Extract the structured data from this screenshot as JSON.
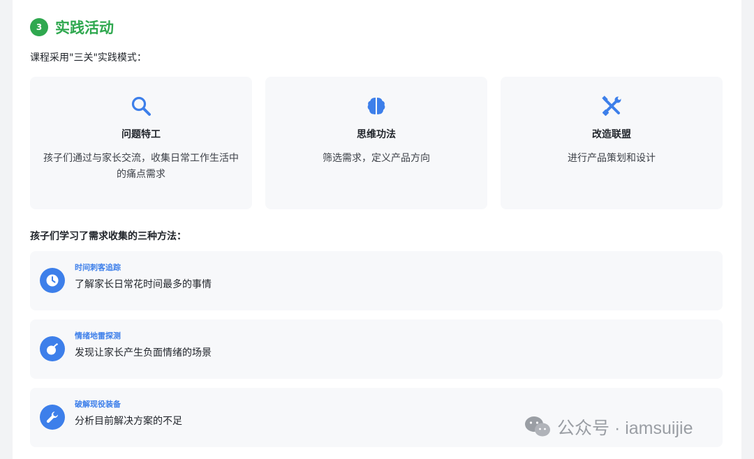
{
  "section": {
    "number": "3",
    "title": "实践活动",
    "intro": "课程采用\"三关\"实践模式："
  },
  "practice_cards": [
    {
      "icon": "search-icon",
      "title": "问题特工",
      "desc": "孩子们通过与家长交流，收集日常工作生活中的痛点需求"
    },
    {
      "icon": "brain-icon",
      "title": "思维功法",
      "desc": "筛选需求，定义产品方向"
    },
    {
      "icon": "tools-icon",
      "title": "改造联盟",
      "desc": "进行产品策划和设计"
    }
  ],
  "methods": {
    "title": "孩子们学习了需求收集的三种方法：",
    "items": [
      {
        "icon": "clock-icon",
        "title": "时间刺客追踪",
        "desc": "了解家长日常花时间最多的事情"
      },
      {
        "icon": "bomb-icon",
        "title": "情绪地雷探测",
        "desc": "发现让家长产生负面情绪的场景"
      },
      {
        "icon": "wrench-icon",
        "title": "破解现役装备",
        "desc": "分析目前解决方案的不足"
      }
    ]
  },
  "watermark": {
    "text": "公众号 · iamsuijie"
  },
  "colors": {
    "green": "#2fa84f",
    "blue": "#3d7fea",
    "card_bg": "#f7f8fa"
  }
}
